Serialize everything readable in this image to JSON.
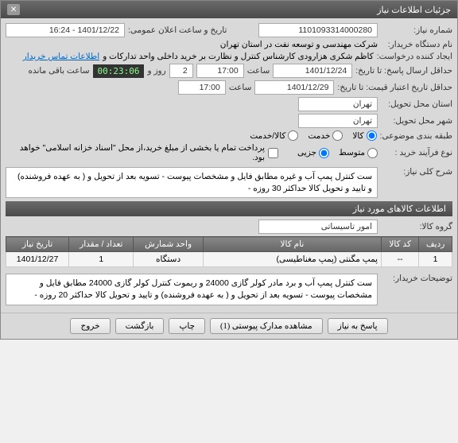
{
  "window": {
    "title": "جزئیات اطلاعات نیاز"
  },
  "form": {
    "need_number_label": "شماره نیاز:",
    "need_number": "1101093314000280",
    "announce_label": "تاریخ و ساعت اعلان عمومی:",
    "announce_value": "1401/12/22 - 16:24",
    "buyer_org_label": "نام دستگاه خریدار:",
    "buyer_org": "شرکت مهندسی و توسعه نفت در استان تهران",
    "creator_label": "ایجاد کننده درخواست:",
    "creator": "کاظم شکری هزارودی کارشناس کنترل و نظارت بر خرید داخلی واحد تدارکات و",
    "contact_link": "اطلاعات تماس خریدار",
    "deadline_label": "حداقل ارسال پاسخ: تا تاریخ:",
    "deadline_date": "1401/12/24",
    "time_label": "ساعت",
    "deadline_time": "17:00",
    "day_label": "روز و",
    "day_value": "2",
    "countdown": "00:23:06",
    "remaining_label": "ساعت باقی مانده",
    "credit_expiry_label": "حداقل تاریخ اعتبار قیمت: تا تاریخ:",
    "credit_expiry_date": "1401/12/29",
    "credit_expiry_time": "17:00",
    "province_label": "استان محل تحویل:",
    "province": "تهران",
    "city_label": "شهر محل تحویل:",
    "city": "تهران",
    "category_label": "طبقه بندی موضوعی:",
    "cat_goods": "کالا",
    "cat_service": "خدمت",
    "cat_both": "کالا/خدمت",
    "process_label": "نوع فرآیند خرید :",
    "proc_mid": "متوسط",
    "proc_small": "جزیی",
    "payment_note": "پرداخت تمام یا بخشی از مبلغ خرید،از محل \"اسناد خزانه اسلامی\" خواهد بود.",
    "desc_label": "شرح کلی نیاز:",
    "desc_text": "ست کنترل پمپ آب و غیره  مطابق فایل و مشخصات پیوست - تسویه بعد از تحویل و ( به عهده فروشنده) و تایید و تحویل  کالا حداکثر 30 روزه -"
  },
  "goods_section": {
    "title": "اطلاعات کالاهای مورد نیاز",
    "group_label": "گروه کالا:",
    "group_value": "امور تاسیساتی"
  },
  "table": {
    "headers": [
      "ردیف",
      "کد کالا",
      "نام کالا",
      "واحد شمارش",
      "تعداد / مقدار",
      "تاریخ نیاز"
    ],
    "rows": [
      {
        "idx": "1",
        "code": "--",
        "name": "پمپ مگنتی (پمپ مغناطیسی)",
        "unit": "دستگاه",
        "qty": "1",
        "date": "1401/12/27"
      }
    ]
  },
  "buyer_notes": {
    "label": "توضیحات خریدار:",
    "text": "ست کنترل پمپ آب و برد مادر کولر گازی 24000 و ریموت کنترل کولر گازی 24000  مطابق فایل و مشخصات پیوست - تسویه بعد از تحویل و ( به عهده فروشنده) و تایید و تحویل  کالا حداکثر 20 روزه -"
  },
  "buttons": {
    "respond": "پاسخ به نیاز",
    "attachments": "مشاهده مدارک پیوستی (1)",
    "print": "چاپ",
    "back": "بازگشت",
    "exit": "خروج"
  }
}
